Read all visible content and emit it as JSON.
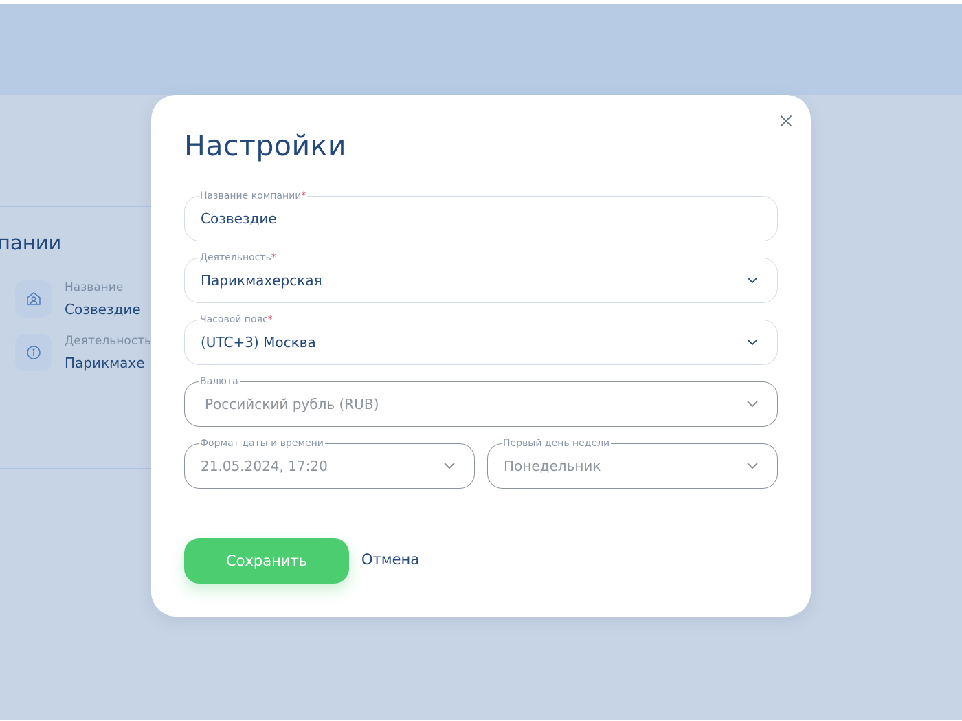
{
  "background": {
    "heading": "пании",
    "rows": [
      {
        "icon": "building-user-icon",
        "label": "Название",
        "value": "Созвездие"
      },
      {
        "icon": "info-icon",
        "label": "Деятельность",
        "value": "Парикмахе"
      }
    ]
  },
  "modal": {
    "title": "Настройки",
    "fields": {
      "company": {
        "label": "Название компании",
        "required_mark": "*",
        "value": "Созвездие"
      },
      "activity": {
        "label": "Деятельность",
        "required_mark": "*",
        "value": "Парикмахерская"
      },
      "timezone": {
        "label": "Часовой пояс",
        "required_mark": "*",
        "value": "(UTC+3) Москва"
      },
      "currency": {
        "label": "Валюта",
        "value": "Российский рубль (RUB)"
      },
      "datetime_format": {
        "label": "Формат даты и времени",
        "value": "21.05.2024, 17:20"
      },
      "first_weekday": {
        "label": "Первый день недели",
        "value": "Понедельник"
      }
    },
    "save_label": "Сохранить",
    "cancel_label": "Отмена"
  },
  "colors": {
    "accent_green": "#4bcd70",
    "text_primary": "#244a7c",
    "required": "#e5556b",
    "overlay": "#c7d4e5"
  }
}
